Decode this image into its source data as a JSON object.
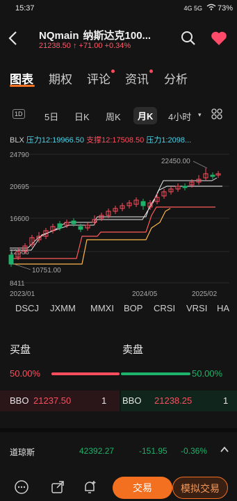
{
  "status": {
    "time": "15:37",
    "battery": "73%",
    "signal": "4G 5G"
  },
  "header": {
    "symbol": "NQmain",
    "name": "纳斯达克100...",
    "price": "21238.50",
    "arrow": "↑",
    "change": "+71.00",
    "change_pct": "+0.34%"
  },
  "tabs": [
    {
      "label": "图表",
      "active": true
    },
    {
      "label": "期权"
    },
    {
      "label": "评论"
    },
    {
      "label": "资讯"
    },
    {
      "label": "分析"
    }
  ],
  "periods": [
    "1D",
    "5日",
    "日K",
    "周K",
    "月K",
    "4小时"
  ],
  "indicators": {
    "name": "BLX",
    "r12": "压力12:19966.50",
    "s12": "支撑12:17508.50",
    "r1": "压力1:2098..."
  },
  "chart_data": {
    "type": "candlestick",
    "y_ticks": [
      "24790",
      "20695",
      "16600",
      "12506",
      "8411"
    ],
    "x_ticks": [
      "2023/01",
      "2024/05",
      "2025/02"
    ],
    "annotations": [
      "22450.00",
      "10751.00"
    ],
    "colors": {
      "up": "#ff4d5e",
      "down": "#1db36a",
      "resistance": "#ffffff",
      "support": "#ffb84d"
    }
  },
  "studies": [
    "DSCJ",
    "JXMM",
    "MMXI",
    "BOP",
    "CRSI",
    "VRSI",
    "HA"
  ],
  "book": {
    "buy_label": "买盘",
    "sell_label": "卖盘",
    "buy_pct": "50.00%",
    "sell_pct": "50.00%",
    "bbo_label": "BBO",
    "bid": "21237.50",
    "bid_qty": "1",
    "ask": "21238.25",
    "ask_qty": "1"
  },
  "ticker": {
    "name": "道琼斯",
    "price": "42392.27",
    "change": "-151.95",
    "pct": "-0.36%"
  },
  "nav": {
    "trade": "交易",
    "sim_trade": "模拟交易"
  }
}
